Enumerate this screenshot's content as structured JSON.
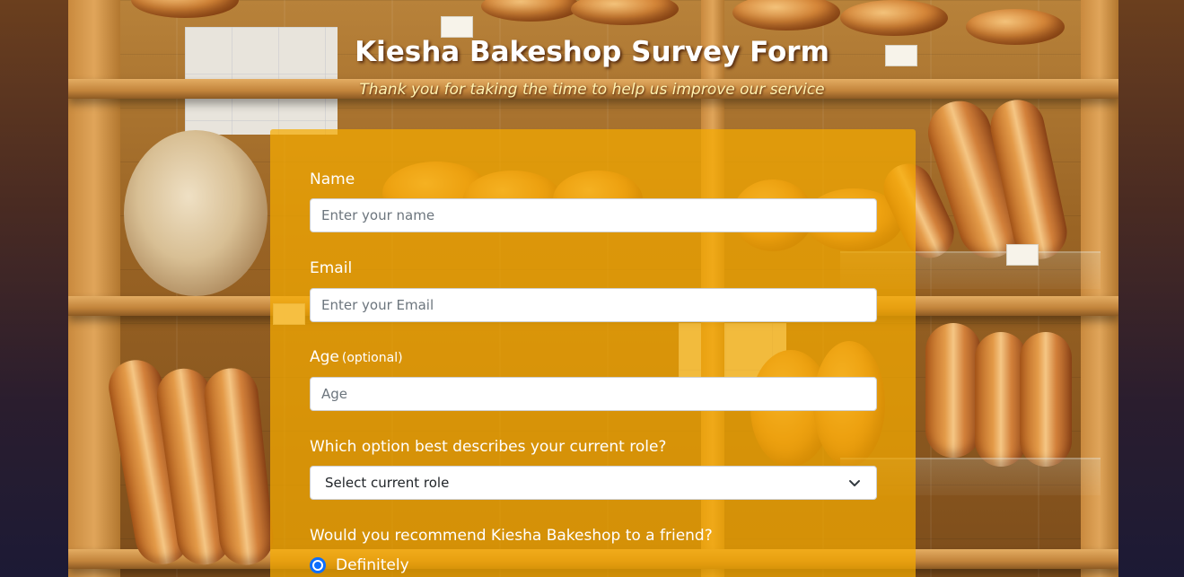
{
  "header": {
    "title": "Kiesha Bakeshop Survey Form",
    "subtitle": "Thank you for taking the time to help us improve our service"
  },
  "form": {
    "name": {
      "label": "Name",
      "placeholder": "Enter your name",
      "value": ""
    },
    "email": {
      "label": "Email",
      "placeholder": "Enter your Email",
      "value": ""
    },
    "age": {
      "label": "Age",
      "optional_note": "(optional)",
      "placeholder": "Age",
      "value": ""
    },
    "role": {
      "label": "Which option best describes your current role?",
      "selected": "Select current role"
    },
    "recommend": {
      "label": "Would you recommend Kiesha Bakeshop to a friend?",
      "options": [
        {
          "label": "Definitely",
          "checked": true
        }
      ]
    }
  },
  "colors": {
    "form_panel": "#f5aa00",
    "radio_accent": "#0d6efd",
    "subtitle": "#fff2b0"
  }
}
